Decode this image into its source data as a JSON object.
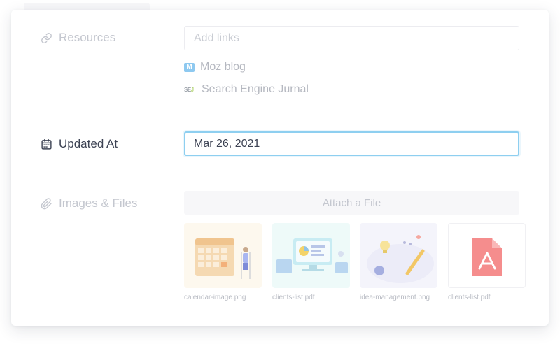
{
  "resources": {
    "label": "Resources",
    "icon": "link-icon",
    "placeholder": "Add links",
    "links": [
      {
        "icon": "moz-icon",
        "icon_text": "M",
        "label": "Moz blog"
      },
      {
        "icon": "sej-icon",
        "icon_text_a": "SE",
        "icon_text_b": "J",
        "label": "Search Engine Jurnal"
      }
    ]
  },
  "updated_at": {
    "label": "Updated At",
    "icon": "calendar-icon",
    "value": "Mar 26, 2021"
  },
  "files": {
    "label": "Images & Files",
    "icon": "paperclip-icon",
    "attach_label": "Attach a File",
    "items": [
      {
        "name": "calendar-image.png",
        "icon": "calendar-illustration"
      },
      {
        "name": "clients-list.pdf",
        "icon": "dashboard-illustration"
      },
      {
        "name": "idea-management.png",
        "icon": "idea-illustration"
      },
      {
        "name": "clients-list.pdf",
        "icon": "pdf-icon"
      }
    ]
  },
  "colors": {
    "focus_border": "#8ecff0",
    "active_text": "#3d4354",
    "faded_text": "#c4c7cf",
    "pdf_red": "#f58d8d"
  }
}
